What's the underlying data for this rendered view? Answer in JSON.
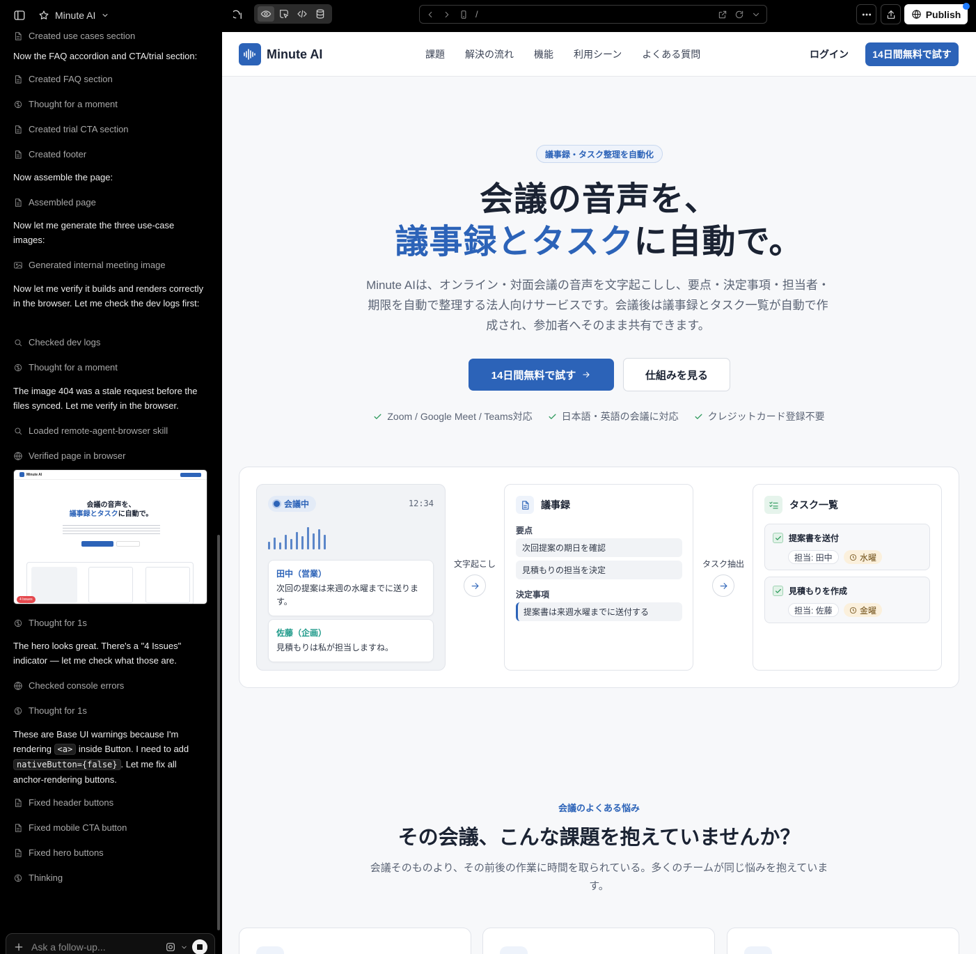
{
  "topbar": {
    "project_name": "Minute AI",
    "url_path": "/",
    "publish_label": "Publish"
  },
  "left_panel": {
    "entries": [
      {
        "kind": "action",
        "icon": "file-icon",
        "text": "Created use cases section"
      },
      {
        "kind": "message",
        "text": "Now the FAQ accordion and CTA/trial section:"
      },
      {
        "kind": "action",
        "icon": "file-icon",
        "text": "Created FAQ section"
      },
      {
        "kind": "action",
        "icon": "brain-icon",
        "text": "Thought for a moment"
      },
      {
        "kind": "action",
        "icon": "file-icon",
        "text": "Created trial CTA section"
      },
      {
        "kind": "action",
        "icon": "file-icon",
        "text": "Created footer"
      },
      {
        "kind": "message",
        "text": "Now assemble the page:"
      },
      {
        "kind": "action",
        "icon": "file-icon",
        "text": "Assembled page"
      },
      {
        "kind": "message",
        "text": "Now let me generate the three use-case images:"
      },
      {
        "kind": "action",
        "icon": "image-icon",
        "text": "Generated internal meeting image"
      },
      {
        "kind": "message",
        "text": "Now let me verify it builds and renders correctly in the browser. Let me check the dev logs first:"
      },
      {
        "kind": "action",
        "icon": "search-icon",
        "text": "Checked dev logs"
      },
      {
        "kind": "action",
        "icon": "brain-icon",
        "text": "Thought for a moment"
      },
      {
        "kind": "message",
        "text": "The image 404 was a stale request before the files synced. Let me verify in the browser."
      },
      {
        "kind": "action",
        "icon": "search-icon",
        "text": "Loaded remote-agent-browser skill"
      },
      {
        "kind": "action",
        "icon": "globe-icon",
        "text": "Verified page in browser"
      },
      {
        "kind": "action",
        "icon": "brain-icon",
        "text": "Thought for 1s"
      },
      {
        "kind": "message",
        "text": "The hero looks great. There's a \"4 Issues\" indicator — let me check what those are."
      },
      {
        "kind": "action",
        "icon": "globe-icon",
        "text": "Checked console errors"
      },
      {
        "kind": "action",
        "icon": "brain-icon",
        "text": "Thought for 1s"
      },
      {
        "kind": "message_code",
        "parts": [
          "These are Base UI warnings because I'm rendering ",
          "<a>",
          " inside Button. I need to add ",
          "nativeButton={false}",
          ". Let me fix all anchor-rendering buttons."
        ]
      },
      {
        "kind": "action",
        "icon": "file-icon",
        "text": "Fixed header buttons"
      },
      {
        "kind": "action",
        "icon": "file-icon",
        "text": "Fixed mobile CTA button"
      },
      {
        "kind": "action",
        "icon": "file-icon",
        "text": "Fixed hero buttons"
      },
      {
        "kind": "action",
        "icon": "brain-icon",
        "text": "Thinking"
      }
    ],
    "thumbnail": {
      "brand": "Minute AI",
      "title_line1": "会議の音声を、",
      "title_line2_blue": "議事録とタスク",
      "title_line2_rest": "に自動で。",
      "issues_badge": "4 Issues"
    },
    "input_placeholder": "Ask a follow-up..."
  },
  "site": {
    "brand": "Minute AI",
    "nav": [
      "課題",
      "解決の流れ",
      "機能",
      "利用シーン",
      "よくある質問"
    ],
    "login": "ログイン",
    "header_cta": "14日間無料で試す",
    "hero": {
      "badge": "議事録・タスク整理を自動化",
      "title_line1": "会議の音声を、",
      "title_line2_blue": "議事録とタスク",
      "title_line2_rest": "に自動で。",
      "description": "Minute AIは、オンライン・対面会議の音声を文字起こしし、要点・決定事項・担当者・期限を自動で整理する法人向けサービスです。会議後は議事録とタスク一覧が自動で作成され、参加者へそのまま共有できます。",
      "cta_primary": "14日間無料で試す",
      "cta_secondary": "仕組みを見る",
      "checks": [
        "Zoom / Google Meet / Teams対応",
        "日本語・英語の会議に対応",
        "クレジットカード登録不要"
      ]
    },
    "demo": {
      "meeting": {
        "status": "会議中",
        "time": "12:34",
        "wave_levels": [
          0.3,
          0.45,
          0.25,
          0.55,
          0.4,
          0.65,
          0.5,
          0.85,
          0.6,
          0.75,
          0.55
        ],
        "transcript": [
          {
            "speaker": "田中（営業）",
            "color": "#2c63b8",
            "text": "次回の提案は来週の水曜までに送ります。"
          },
          {
            "speaker": "佐藤（企画）",
            "color": "#1f9a8a",
            "text": "見積もりは私が担当しますね。"
          }
        ]
      },
      "arrow1_label": "文字起こし",
      "arrow2_label": "タスク抽出",
      "minutes": {
        "title": "議事録",
        "points_heading": "要点",
        "points": [
          "次回提案の期日を確認",
          "見積もりの担当を決定"
        ],
        "decisions_heading": "決定事項",
        "decisions": [
          "提案書は来週水曜までに送付する"
        ]
      },
      "tasks": {
        "title": "タスク一覧",
        "items": [
          {
            "title": "提案書を送付",
            "owner": "担当: 田中",
            "due": "水曜"
          },
          {
            "title": "見積もりを作成",
            "owner": "担当: 佐藤",
            "due": "金曜"
          }
        ]
      }
    },
    "problems": {
      "eyebrow": "会議のよくある悩み",
      "title": "その会議、こんな課題を抱えていませんか？",
      "description": "会議そのものより、その前後の作業に時間を取られている。多くのチームが同じ悩みを抱えています。"
    },
    "colors": {
      "primary": "#2c63b8",
      "check_green": "#2e9a5c",
      "due_chip": "#fbf0dc"
    }
  }
}
